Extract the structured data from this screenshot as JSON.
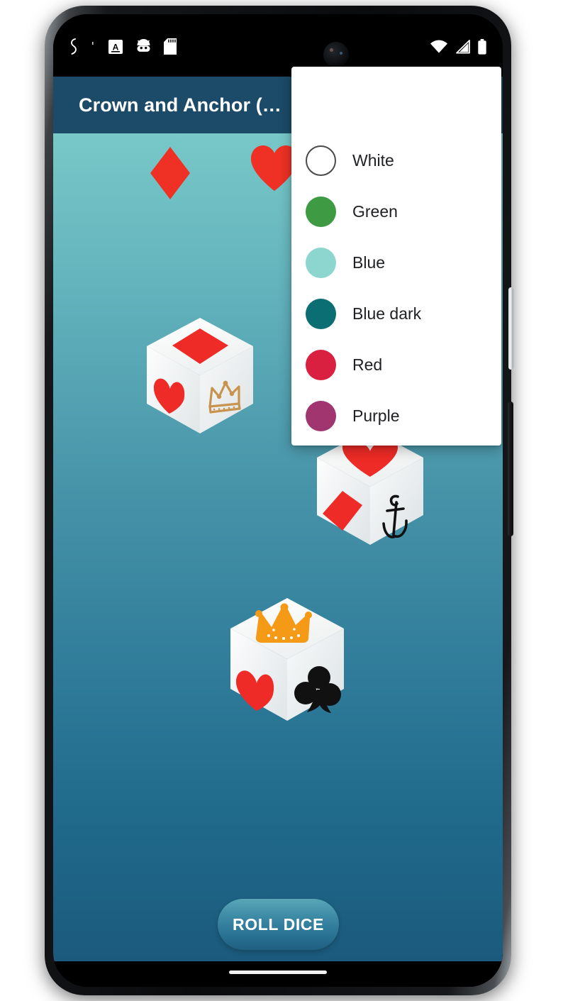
{
  "status_bar": {
    "left_icons": [
      "squiggle-icon",
      "a-in-box-icon",
      "android-head-icon",
      "sd-card-icon"
    ],
    "right_icons": [
      "wifi-icon",
      "cellular-signal-icon",
      "battery-icon"
    ]
  },
  "app_bar": {
    "title": "Crown and Anchor (…"
  },
  "board": {
    "suit_indicators": [
      {
        "name": "diamond",
        "color": "#EE3124"
      },
      {
        "name": "heart",
        "color": "#EE3124"
      }
    ],
    "dice": [
      {
        "id": "die-1",
        "top_face": {
          "symbol": "diamond",
          "color": "#EE2B26"
        },
        "left_face": {
          "symbol": "heart",
          "color": "#EE2B26"
        },
        "right_face": {
          "symbol": "crown",
          "color": "#C8934F"
        }
      },
      {
        "id": "die-2",
        "top_face": {
          "symbol": "heart",
          "color": "#EE2B26"
        },
        "left_face": {
          "symbol": "diamond",
          "color": "#EE2B26"
        },
        "right_face": {
          "symbol": "anchor",
          "color": "#111111"
        }
      },
      {
        "id": "die-3",
        "top_face": {
          "symbol": "crown",
          "color": "#F59A16"
        },
        "left_face": {
          "symbol": "heart",
          "color": "#EE2B26"
        },
        "right_face": {
          "symbol": "club",
          "color": "#111111"
        }
      }
    ]
  },
  "roll_button": {
    "label": "ROLL DICE"
  },
  "color_menu": {
    "items": [
      {
        "label": "White",
        "color": "#FFFFFF",
        "outlined": true
      },
      {
        "label": "Green",
        "color": "#3E9A43",
        "outlined": false
      },
      {
        "label": "Blue",
        "color": "#8DD6D0",
        "outlined": false
      },
      {
        "label": "Blue dark",
        "color": "#0A6E72",
        "outlined": false
      },
      {
        "label": "Red",
        "color": "#D92040",
        "outlined": false
      },
      {
        "label": "Purple",
        "color": "#A13570",
        "outlined": false
      }
    ]
  },
  "theme": {
    "app_bar_color": "#1B4B68",
    "background_top": "#78C8C8",
    "background_bottom": "#1B5A7C",
    "button_color": "#2B7495"
  }
}
